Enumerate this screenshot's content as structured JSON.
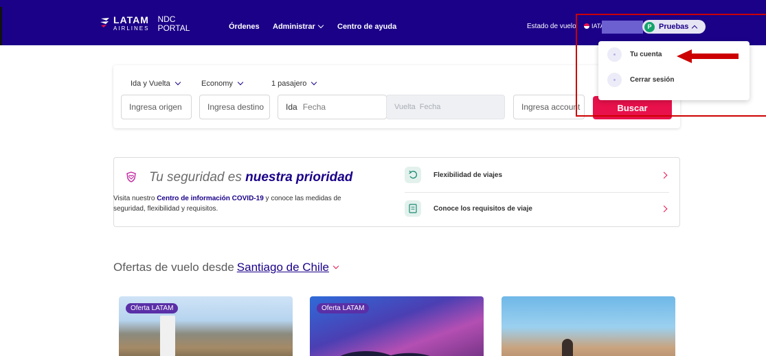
{
  "header": {
    "brand_main": "LATAM",
    "brand_sub": "AIRLINES",
    "portal_line1": "NDC",
    "portal_line2": "PORTAL",
    "nav": {
      "ordenes": "Órdenes",
      "administrar": "Administrar",
      "ayuda": "Centro de ayuda"
    },
    "estado_vuelo": "Estado de vuelo",
    "iata_prefix": "IATA-",
    "user": {
      "initial": "P",
      "name": "Pruebas"
    }
  },
  "user_menu": {
    "items": [
      {
        "label": "Tu cuenta"
      },
      {
        "label": "Cerrar sesión"
      }
    ]
  },
  "search": {
    "trip_type": "Ida y Vuelta",
    "cabin": "Economy",
    "passengers": "1 pasajero",
    "origin_placeholder": "Ingresa origen",
    "destination_placeholder": "Ingresa destino",
    "ida_label": "Ida",
    "ida_placeholder": "Fecha",
    "vuelta_label": "Vuelta",
    "vuelta_placeholder": "Fecha",
    "account_placeholder": "Ingresa account",
    "submit": "Buscar"
  },
  "safety": {
    "title_prefix": "Tu seguridad es ",
    "title_bold": "nuestra prioridad",
    "desc_pre": "Visita nuestro ",
    "desc_link": "Centro de información COVID-19",
    "desc_post": " y conoce las medidas de seguridad, flexibilidad y requisitos.",
    "links": [
      {
        "label": "Flexibilidad de viajes"
      },
      {
        "label": "Conoce los requisitos de viaje"
      }
    ]
  },
  "offers": {
    "title_prefix": "Ofertas de vuelo desde ",
    "city": "Santiago de Chile",
    "cards": [
      {
        "badge": "Oferta LATAM"
      },
      {
        "badge": "Oferta LATAM"
      },
      {
        "badge": ""
      }
    ]
  },
  "colors": {
    "brand": "#1b0088",
    "accent": "#e8114b",
    "annotation": "#cc0000"
  }
}
